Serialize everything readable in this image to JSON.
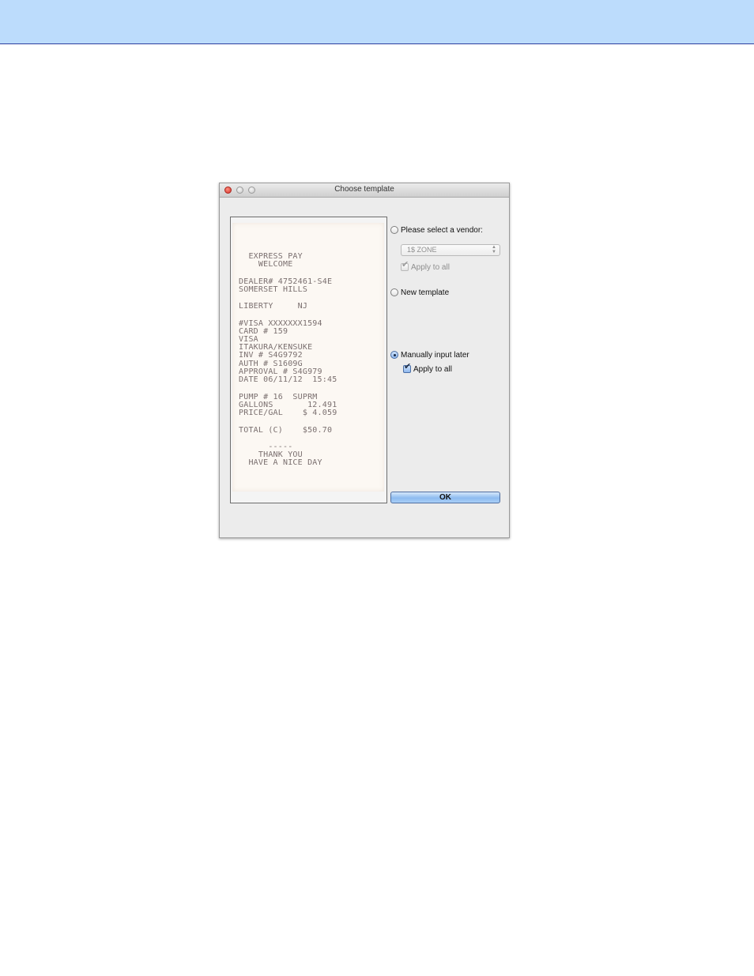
{
  "window": {
    "title": "Choose template"
  },
  "receipt": {
    "lines": [
      "  EXPRESS PAY",
      "    WELCOME",
      "DEALER# 4752461-S4E",
      "SOMERSET HILLS",
      "LIBERTY     NJ",
      "#VISA XXXXXXX1594",
      "CARD # 159",
      "VISA",
      "ITAKURA/KENSUKE",
      "INV # S4G9792",
      "AUTH # S1609G",
      "APPROVAL # S4G979",
      "DATE 06/11/12  15:45",
      "PUMP # 16  SUPRM",
      "GALLONS       12.491",
      "PRICE/GAL    $ 4.059",
      "TOTAL (C)    $50.70",
      "      -----",
      "    THANK YOU",
      "  HAVE A NICE DAY"
    ]
  },
  "options": {
    "vendor": {
      "label": "Please select a vendor:",
      "selected": false,
      "dropdown_value": "1$ ZONE",
      "apply_all_label": "Apply to all",
      "apply_all_checked": true,
      "enabled": false
    },
    "new_template": {
      "label": "New template",
      "selected": false
    },
    "manual": {
      "label": "Manually input later",
      "selected": true,
      "apply_all_label": "Apply to all",
      "apply_all_checked": true
    }
  },
  "buttons": {
    "ok_label": "OK"
  },
  "colors": {
    "banner": "#bcdcfc",
    "banner_rule": "#2d3f9e",
    "window_bg": "#ececec",
    "ok_button": "#8dbbf0"
  }
}
